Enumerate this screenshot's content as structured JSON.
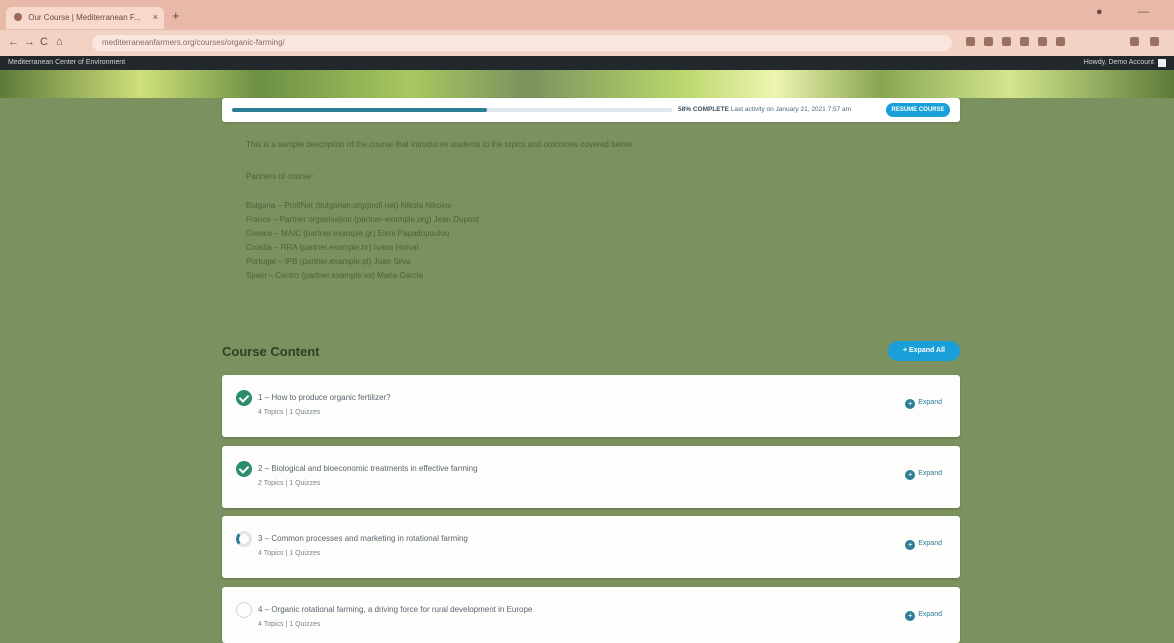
{
  "browser": {
    "tab_title": "Our Course | Mediterranean F...",
    "tab_close": "×",
    "new_tab": "+",
    "url": "mediterraneanfarmers.org/courses/organic-farming/",
    "nav_back": "←",
    "nav_forward": "→",
    "nav_reload": "C",
    "nav_home": "⌂",
    "win_min": "—",
    "win_max": "◻"
  },
  "adminbar": {
    "site": "Mediterranean Center of Environment",
    "howdy": "Howdy, Demo Account"
  },
  "progress": {
    "percent_complete": 0.58,
    "complete_label": "58% COMPLETE",
    "last_activity": "Last activity on January 21, 2021 7:57 am",
    "resume_label": "RESUME COURSE"
  },
  "description": {
    "intro": "This is a sample description of the course that introduces students to the topics and outcomes covered below.",
    "authors_heading": "Partners of course:",
    "partners": [
      "Bulgaria – ProfiNet (bulgarian.org/profi net) Nikola Nikolov",
      "France – Partner organisation (partner-example.org) Jean Dupont",
      "Greece – MAIC (partner.example.gr) Eleni Papadopoulou",
      "Croatia – RRA (partner.example.hr) Ivana Horvat",
      "Portugal – IPB (partner.example.pt) Joao Silva",
      "Spain – Centro (partner.example.es) Maria Garcia"
    ]
  },
  "course_content": {
    "title": "Course Content",
    "expand_all": "+ Expand All",
    "lessons": [
      {
        "title": "1 – How to produce organic fertilizer?",
        "meta": "4 Topics  |  1 Quizzes",
        "status": "complete",
        "expand": "Expand"
      },
      {
        "title": "2 – Biological and bioeconomic treatments in effective farming",
        "meta": "2 Topics  |  1 Quizzes",
        "status": "complete",
        "expand": "Expand"
      },
      {
        "title": "3 – Common processes and marketing in rotational farming",
        "meta": "4 Topics  |  1 Quizzes",
        "status": "in-progress",
        "expand": "Expand"
      },
      {
        "title": "4 – Organic rotational farming, a driving force for rural development in Europe",
        "meta": "4 Topics  |  1 Quizzes",
        "status": "not-started",
        "expand": "Expand"
      }
    ]
  },
  "colors": {
    "page_bg": "#7b915f",
    "accent": "#1aa0d8",
    "complete": "#2c8c6c",
    "progress": "#2c7d96"
  }
}
